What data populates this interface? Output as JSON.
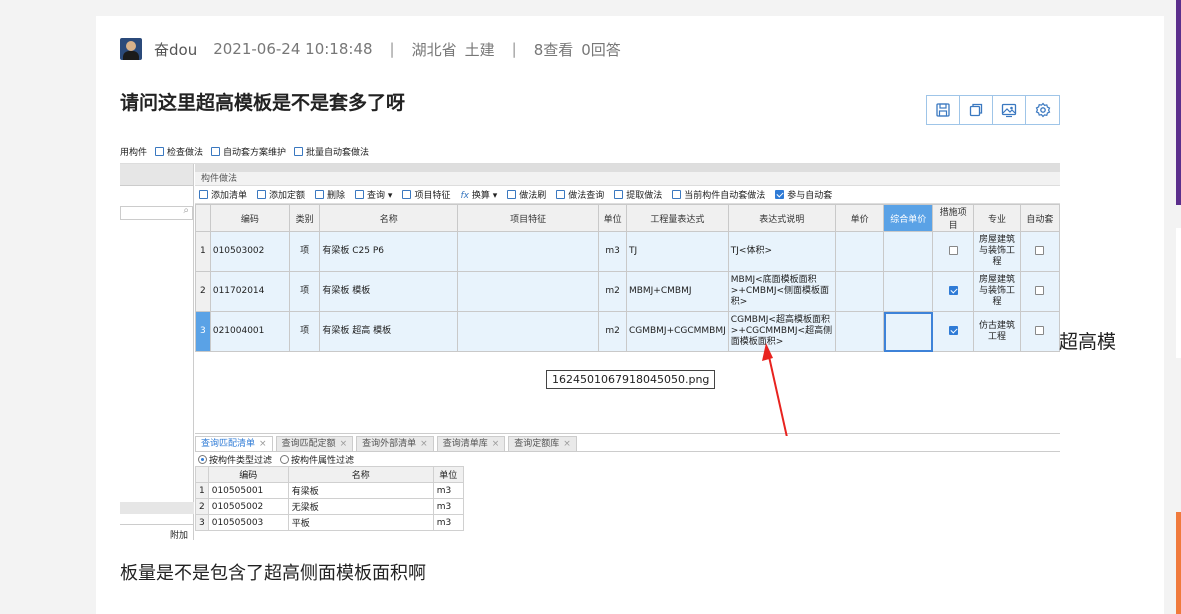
{
  "post": {
    "username": "奋dou",
    "datetime": "2021-06-24 10:18:48",
    "location": "湖北省",
    "category": "土建",
    "views": "8查看",
    "answers": "0回答",
    "title": "请问这里超高模板是不是套多了呀",
    "overflow_text": "超高模",
    "question_text": "板量是不是包含了超高侧面模板面积啊"
  },
  "toolbar_icons": [
    "save-icon",
    "copy-icon",
    "image-icon",
    "settings-icon"
  ],
  "screenshot": {
    "top_bar": [
      "用构件",
      "检查做法",
      "自动套方案维护",
      "批量自动套做法"
    ],
    "panel_title": "构件做法",
    "actions": [
      "添加清单",
      "添加定额",
      "删除",
      "查询",
      "项目特征",
      "换算",
      "做法刷",
      "做法查询",
      "提取做法",
      "当前构件自动套做法",
      "参与自动套"
    ],
    "columns": [
      "编码",
      "类别",
      "名称",
      "项目特征",
      "单位",
      "工程量表达式",
      "表达式说明",
      "单价",
      "综合单价",
      "措施项目",
      "专业",
      "自动套"
    ],
    "rows": [
      {
        "idx": "1",
        "code": "010503002",
        "type": "项",
        "name": "有梁板 C25 P6",
        "feature": "",
        "unit": "m3",
        "expr": "TJ",
        "desc": "TJ<体积>",
        "price": "",
        "total": "",
        "measure": false,
        "major": "房屋建筑与装饰工程",
        "auto": false
      },
      {
        "idx": "2",
        "code": "011702014",
        "type": "项",
        "name": "有梁板 模板",
        "feature": "",
        "unit": "m2",
        "expr": "MBMJ+CMBMJ",
        "desc": "MBMJ<底面模板面积>+CMBMJ<侧面模板面积>",
        "price": "",
        "total": "",
        "measure": true,
        "major": "房屋建筑与装饰工程",
        "auto": false
      },
      {
        "idx": "3",
        "code": "021004001",
        "type": "项",
        "name": "有梁板 超高 模板",
        "feature": "",
        "unit": "m2",
        "expr": "CGMBMJ+CGCMMBMJ",
        "desc": "CGMBMJ<超高模板面积>+CGCMMBMJ<超高侧面模板面积>",
        "price": "",
        "total": "",
        "measure": true,
        "major": "仿古建筑工程",
        "auto": false
      }
    ],
    "filename_tag": "1624501067918045050.png",
    "bottom_tabs": [
      "查询匹配清单",
      "查询匹配定额",
      "查询外部清单",
      "查询清单库",
      "查询定额库"
    ],
    "filters": [
      "按构件类型过滤",
      "按构件属性过滤"
    ],
    "sub_columns": [
      "编码",
      "名称",
      "单位"
    ],
    "sub_rows": [
      {
        "idx": "1",
        "code": "010505001",
        "name": "有梁板",
        "unit": "m3"
      },
      {
        "idx": "2",
        "code": "010505002",
        "name": "无梁板",
        "unit": "m3"
      },
      {
        "idx": "3",
        "code": "010505003",
        "name": "平板",
        "unit": "m3"
      }
    ],
    "left_extra": "附加"
  },
  "colors": {
    "accent": "#2f7bd6",
    "arrow": "#e8231f",
    "selected_header": "#5aa2e6",
    "row_fill": "#e8f3fc"
  }
}
